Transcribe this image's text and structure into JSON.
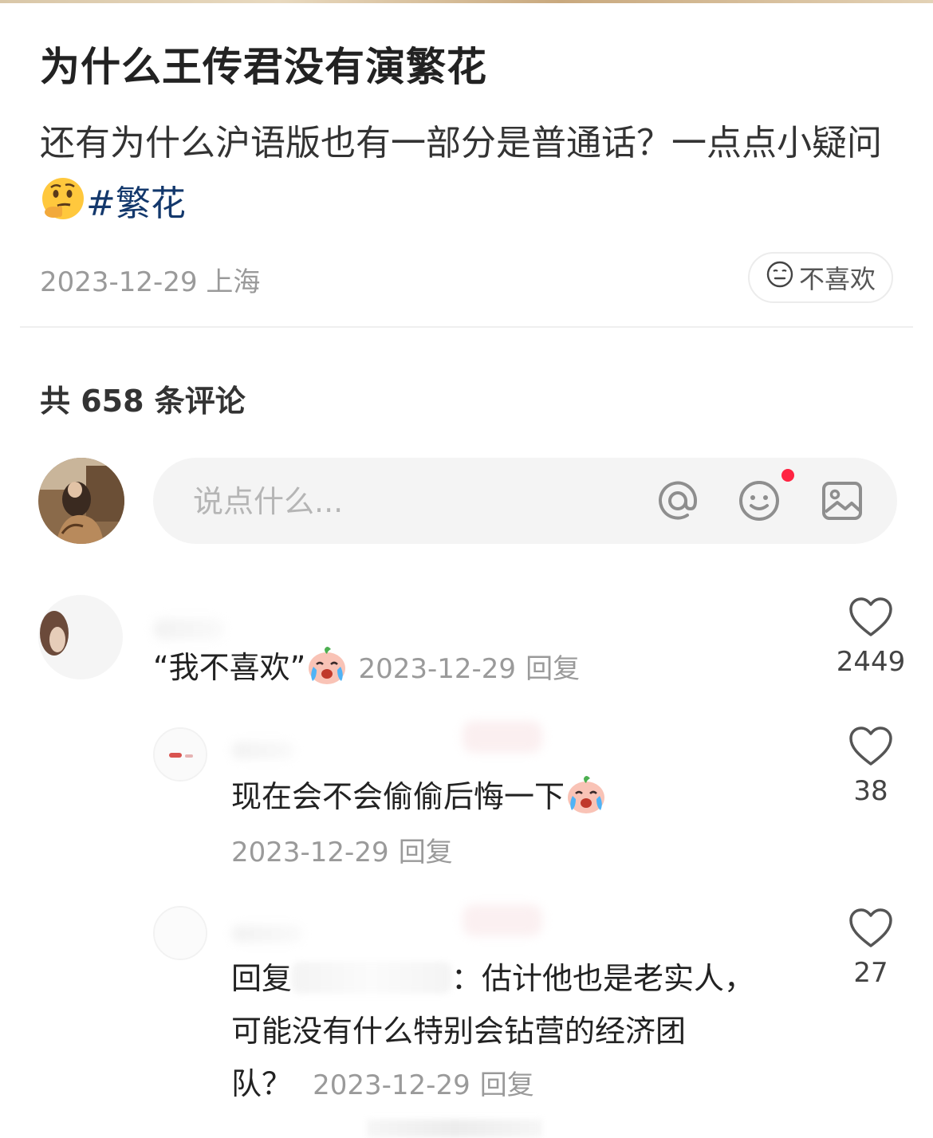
{
  "post": {
    "title": "为什么王传君没有演繁花",
    "body": "还有为什么沪语版也有一部分是普通话？一点点小疑问",
    "hashtag": "#繁花",
    "date": "2023-12-29",
    "location": "上海",
    "dislike_label": "不喜欢",
    "emoji": "thinking-face"
  },
  "comments_header": {
    "label": "共 658 条评论"
  },
  "comment_input": {
    "placeholder": "说点什么..."
  },
  "comments": [
    {
      "text": "“我不喜欢”",
      "emoji": "crying-face",
      "date": "2023-12-29",
      "reply_label": "回复",
      "likes": "2449"
    },
    {
      "text": "现在会不会偷偷后悔一下",
      "emoji": "crying-face",
      "date": "2023-12-29",
      "reply_label": "回复",
      "likes": "38"
    },
    {
      "reply_prefix": "回复",
      "text_line1": "：估计他也是老实人，",
      "text_line2": "可能没有什么特别会钻营的经济团",
      "text_line3": "队？",
      "date": "2023-12-29",
      "reply_label": "回复",
      "likes": "27"
    }
  ],
  "colors": {
    "hashtag": "#13386c",
    "notification_dot": "#ff2442",
    "meta_gray": "#9a9a9a",
    "input_bg": "#f4f4f4"
  }
}
